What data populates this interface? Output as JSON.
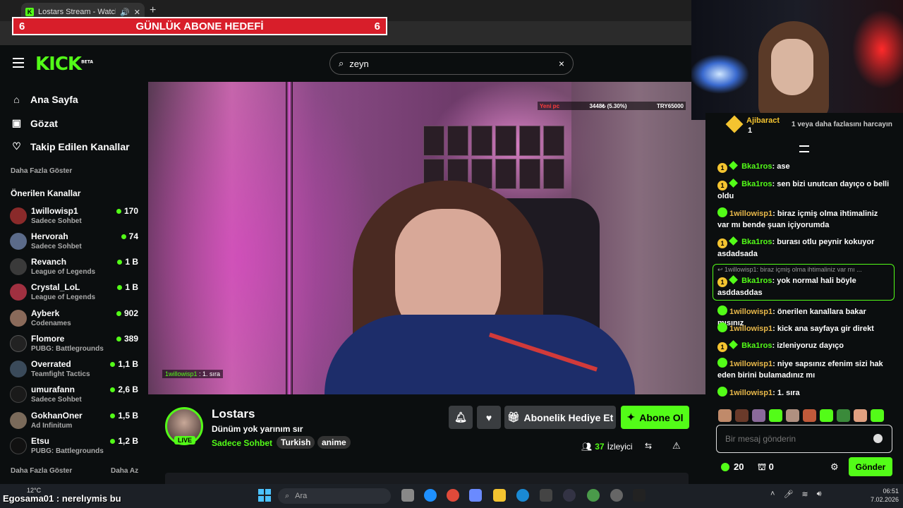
{
  "browser": {
    "tab_title": "Lostars Stream - Watch Live",
    "new_tab": "+"
  },
  "overlay": {
    "goal_left": "6",
    "goal_label": "GÜNLÜK ABONE HEDEFİ",
    "goal_right": "6"
  },
  "header": {
    "logo": "KICK",
    "logo_beta": "BETA",
    "search_value": "zeyn",
    "clear": "×"
  },
  "sidebar": {
    "nav": [
      {
        "label": "Ana Sayfa",
        "icon": "home-icon"
      },
      {
        "label": "Gözat",
        "icon": "browse-icon"
      },
      {
        "label": "Takip Edilen Kanallar",
        "icon": "heart-icon"
      }
    ],
    "show_more_top": "Daha Fazla Göster",
    "recommended_title": "Önerilen Kanallar",
    "channels": [
      {
        "name": "1willowisp1",
        "category": "Sadece Sohbet",
        "viewers": "170",
        "color": "#8a2a2a"
      },
      {
        "name": "Hervorah",
        "category": "Sadece Sohbet",
        "viewers": "74",
        "color": "#5b6b8a"
      },
      {
        "name": "Revanch",
        "category": "League of Legends",
        "viewers": "1 B",
        "color": "#3a3a3a"
      },
      {
        "name": "Crystal_LoL",
        "category": "League of Legends",
        "viewers": "1 B",
        "color": "#a03040"
      },
      {
        "name": "Ayberk",
        "category": "Codenames",
        "viewers": "902",
        "color": "#8a6a5a"
      },
      {
        "name": "Flomore",
        "category": "PUBG: Battlegrounds",
        "viewers": "389",
        "color": "#222"
      },
      {
        "name": "Overrated",
        "category": "Teamfight Tactics",
        "viewers": "1,1 B",
        "color": "#3a4a5a"
      },
      {
        "name": "umurafann",
        "category": "Sadece Sohbet",
        "viewers": "2,6 B",
        "color": "#1a1a1a"
      },
      {
        "name": "GokhanOner",
        "category": "Ad Infinitum",
        "viewers": "1,5 B",
        "color": "#7a6a5a"
      },
      {
        "name": "Etsu",
        "category": "PUBG: Battlegrounds",
        "viewers": "1,2 B",
        "color": "#111"
      }
    ],
    "show_more_bottom": "Daha Fazla Göster",
    "show_less": "Daha Az"
  },
  "video": {
    "hud_label": "Yeni pc",
    "hud_value": "3448₺ (5.30%)",
    "hud_target": "TRY65000",
    "overlay_user": "1willowisp1",
    "overlay_msg": " : 1. sıra"
  },
  "stream": {
    "live": "LIVE",
    "name": "Lostars",
    "title": "Dünüm yok yarınım sır",
    "category": "Sadece Sohbet",
    "tags": [
      "Turkish",
      "anime"
    ],
    "gift_sub": "Abonelik Hediye Et",
    "subscribe": "Abone Ol",
    "viewers": "37",
    "viewers_label": "İzleyici"
  },
  "chat": {
    "gifter_name": "Ajibaract",
    "gifter_count": "1",
    "gift_prompt": "1 veya daha fazlasını harcayın",
    "messages": [
      {
        "user": "Bka1ros",
        "text": "ase",
        "type": "gold"
      },
      {
        "user": "Bka1ros",
        "text": "sen bizi unutcan dayıço o belli oldu",
        "type": "gold"
      },
      {
        "user": "1willowisp1",
        "text": "biraz içmiş olma ihtimaliniz var mı bende şuan içiyorumda",
        "type": "green"
      },
      {
        "user": "Bka1ros",
        "text": "burası otlu peynir kokuyor asdadsada",
        "type": "gold"
      },
      {
        "user": "Bka1ros",
        "text": "yok normal hali böyle asddasddas",
        "type": "gold"
      },
      {
        "user": "1willowisp1",
        "text": "önerilen kanallara bakar mısınız",
        "type": "green"
      },
      {
        "user": "1willowisp1",
        "text": "kick ana sayfaya gir direkt",
        "type": "green"
      },
      {
        "user": "Bka1ros",
        "text": "izleniyoruz dayıço",
        "type": "gold"
      },
      {
        "user": "1willowisp1",
        "text": "niye sapsınız efenim sizi hak eden birini bulamadınız mı",
        "type": "green"
      },
      {
        "user": "1willowisp1",
        "text": "1. sıra",
        "type": "green"
      }
    ],
    "reply_hint": "↩ 1willowisp1: biraz içmiş olma ihtimaliniz var mı ...",
    "input_placeholder": "Bir mesaj gönderin",
    "points": "20",
    "store_count": "0",
    "send": "Gönder"
  },
  "taskbar": {
    "weather": "12°C",
    "overlay_text": "Egosama01 : nerelıymis bu",
    "search": "Ara",
    "time": "06:51",
    "date": "7.02.2026"
  }
}
